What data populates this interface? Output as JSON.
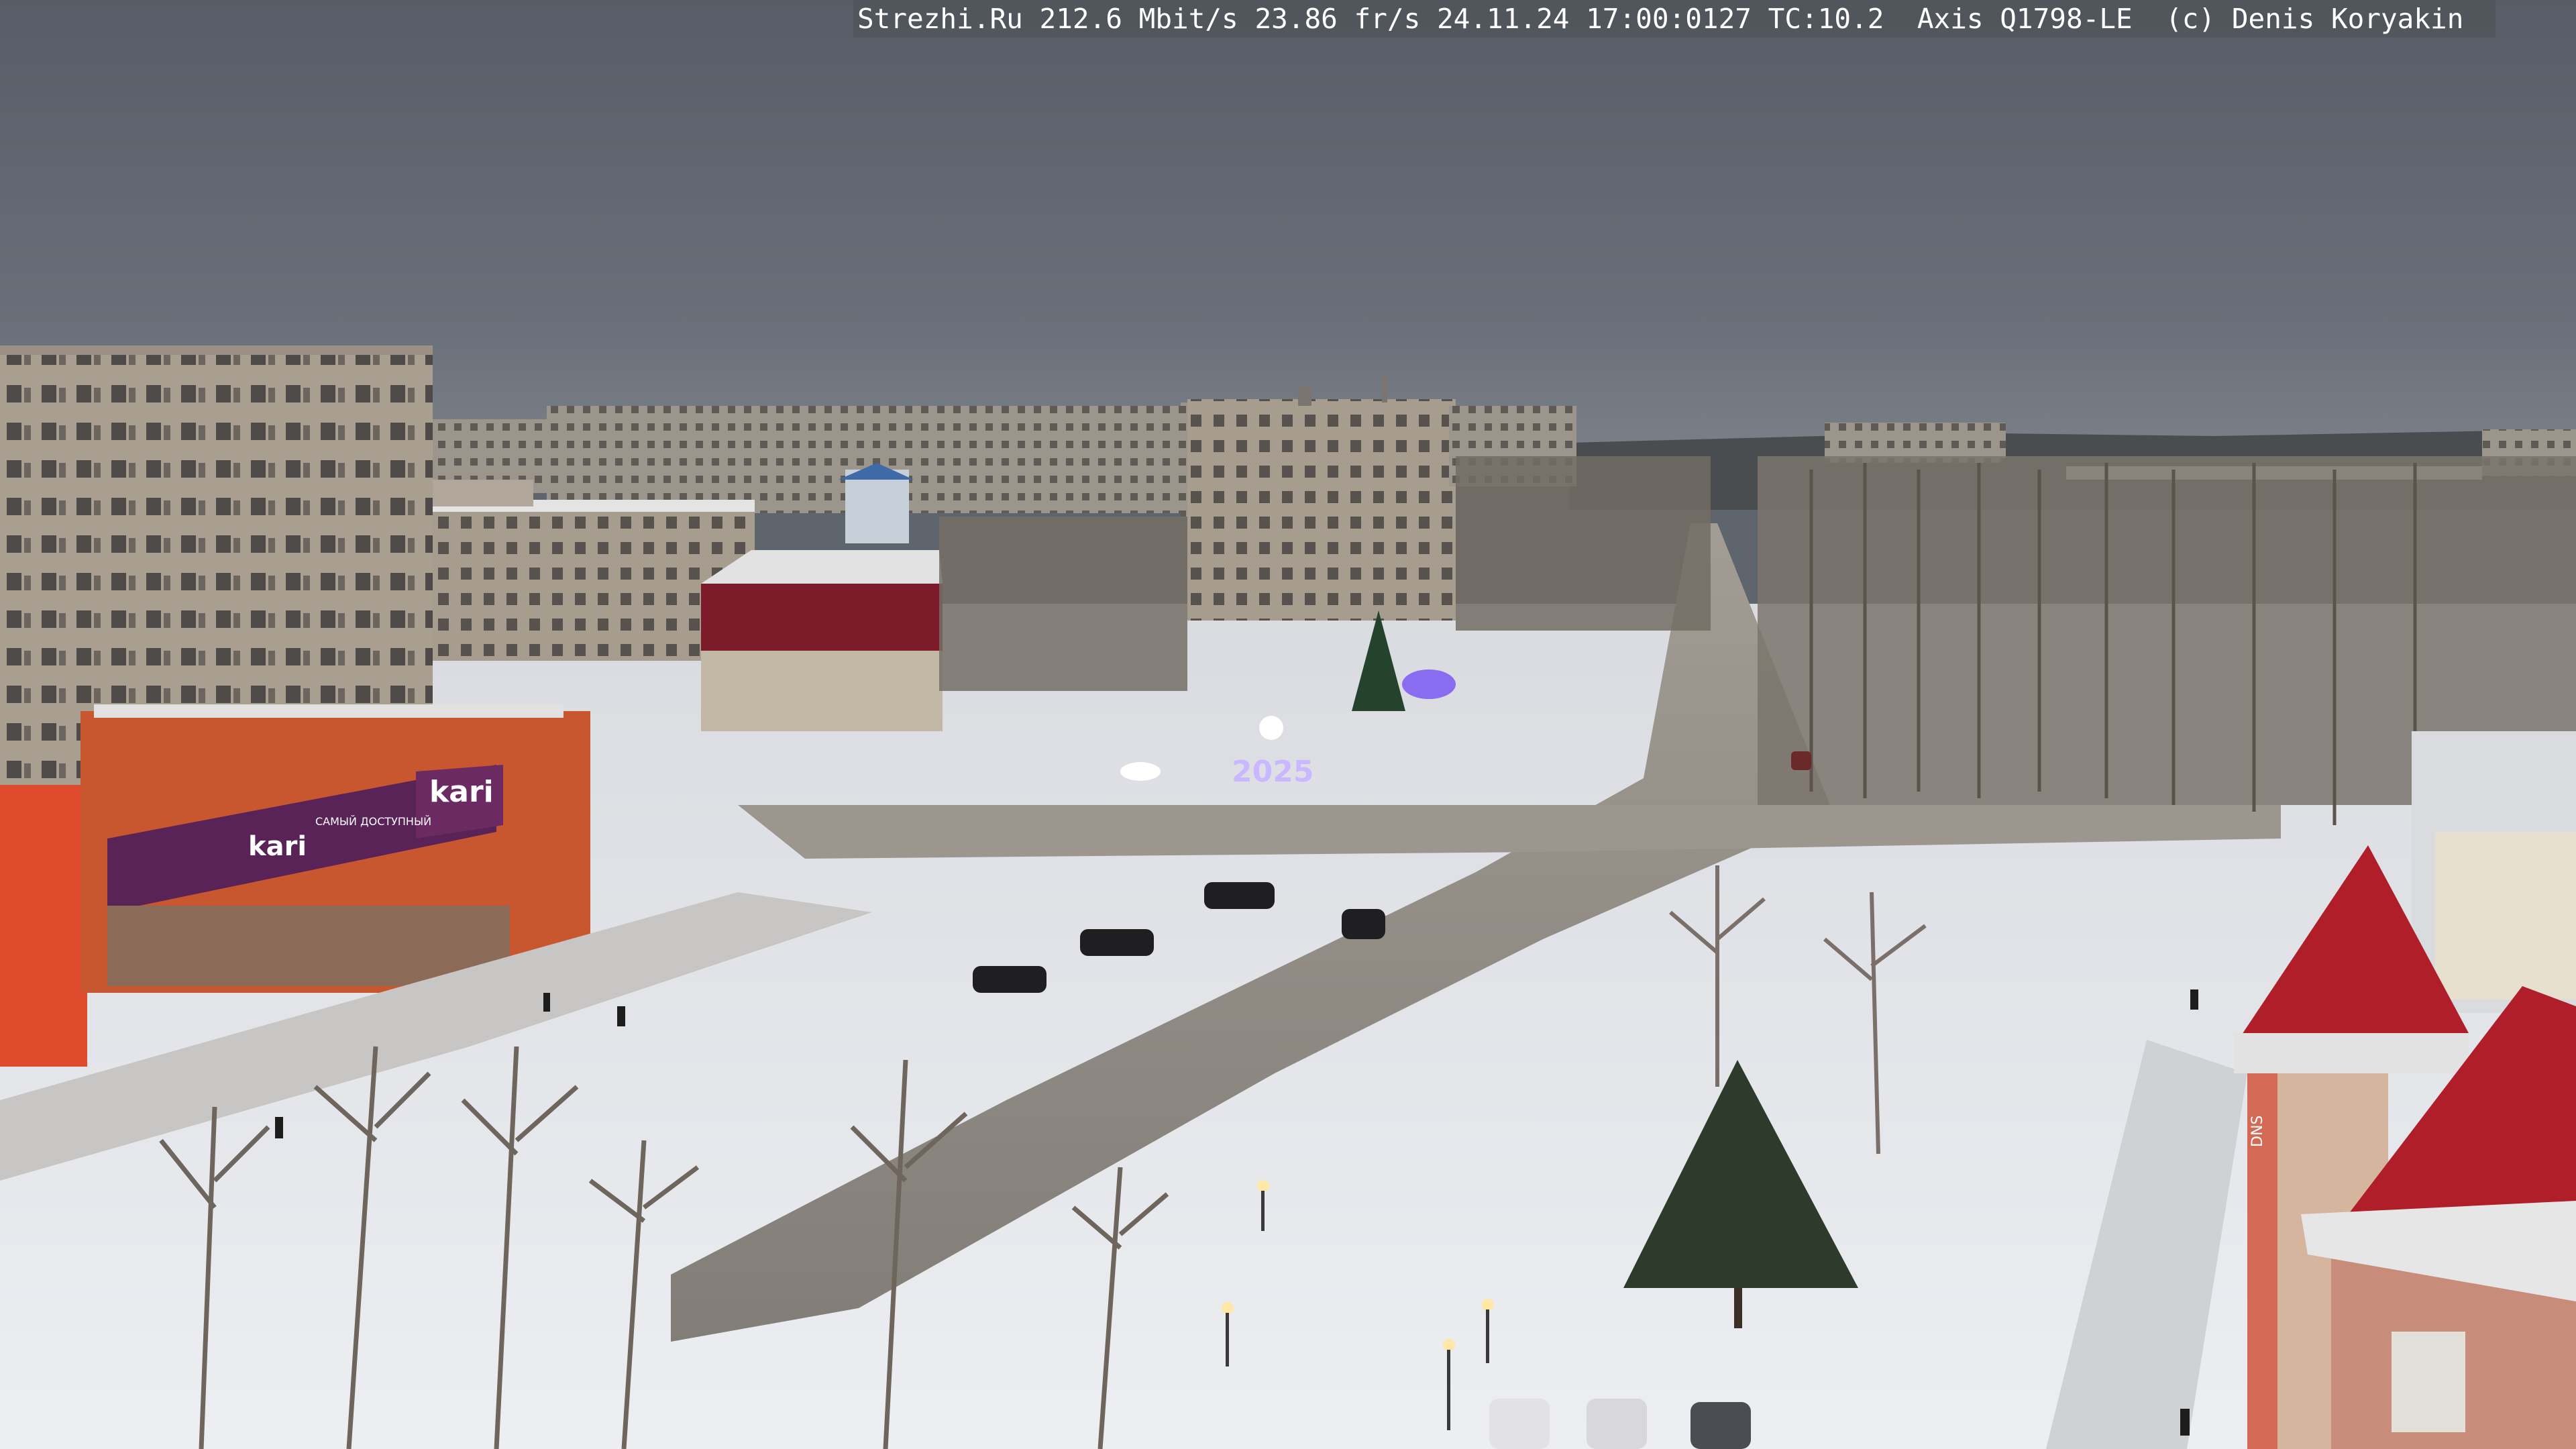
{
  "overlay": {
    "site": "Strezhi.Ru",
    "bitrate": "212.6 Mbit/s",
    "fps": "23.86 fr/s",
    "timestamp": "24.11.24 17:00:0127",
    "tc": "TC:10.2",
    "camera": "Axis Q1798-LE",
    "copyright": "(c) Denis Koryakin"
  },
  "signs": {
    "store_logo": "kari",
    "store_logo_upper": "kari",
    "store_tagline": "САМЫЙ ДОСТУПНЫЙ",
    "year_display": "2025",
    "tall_building_sign": "DNS"
  },
  "colors": {
    "sky": "#5c626a",
    "snow": "#e6e8ec",
    "road": "#8f8d8a",
    "panel_buildings": "#a89e8e",
    "store_orange": "#c7552e",
    "store_purple": "#6b2a62",
    "roof_red": "#b01e2a",
    "trees_bare": "#6b625a",
    "spruce": "#2e3a2c"
  }
}
